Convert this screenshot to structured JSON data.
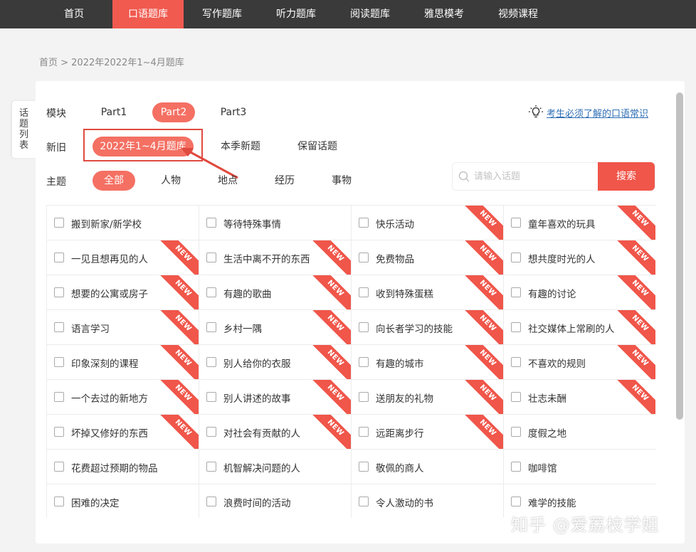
{
  "nav": {
    "items": [
      {
        "label": "首页",
        "active": false
      },
      {
        "label": "口语题库",
        "active": true
      },
      {
        "label": "写作题库",
        "active": false
      },
      {
        "label": "听力题库",
        "active": false
      },
      {
        "label": "阅读题库",
        "active": false
      },
      {
        "label": "雅思模考",
        "active": false
      },
      {
        "label": "视频课程",
        "active": false
      }
    ]
  },
  "breadcrumb": "首页 > 2022年2022年1~4月题库",
  "side_tab": [
    "话",
    "题",
    "列",
    "表"
  ],
  "filters": {
    "module": {
      "label": "模块",
      "options": [
        "Part1",
        "Part2",
        "Part3"
      ],
      "selected": "Part2"
    },
    "age": {
      "label": "新旧",
      "options": [
        "2022年1~4月题库",
        "本季新题",
        "保留话题"
      ],
      "selected": "2022年1~4月题库"
    },
    "theme": {
      "label": "主题",
      "options": [
        "全部",
        "人物",
        "地点",
        "经历",
        "事物"
      ],
      "selected": "全部"
    }
  },
  "tip_link": "考生必须了解的口语常识",
  "search": {
    "placeholder": "请输入话题",
    "button": "搜索"
  },
  "topics": [
    [
      {
        "t": "搬到新家/新学校",
        "new": false
      },
      {
        "t": "等待特殊事情",
        "new": false
      },
      {
        "t": "快乐活动",
        "new": true
      },
      {
        "t": "童年喜欢的玩具",
        "new": true
      }
    ],
    [
      {
        "t": "一见且想再见的人",
        "new": true
      },
      {
        "t": "生活中离不开的东西",
        "new": true
      },
      {
        "t": "免费物品",
        "new": true
      },
      {
        "t": "想共度时光的人",
        "new": true
      }
    ],
    [
      {
        "t": "想要的公寓或房子",
        "new": true
      },
      {
        "t": "有趣的歌曲",
        "new": true
      },
      {
        "t": "收到特殊蛋糕",
        "new": true
      },
      {
        "t": "有趣的讨论",
        "new": true
      }
    ],
    [
      {
        "t": "语言学习",
        "new": true
      },
      {
        "t": "乡村一隅",
        "new": true
      },
      {
        "t": "向长者学习的技能",
        "new": true
      },
      {
        "t": "社交媒体上常刷的人",
        "new": true
      }
    ],
    [
      {
        "t": "印象深刻的课程",
        "new": true
      },
      {
        "t": "别人给你的衣服",
        "new": true
      },
      {
        "t": "有趣的城市",
        "new": true
      },
      {
        "t": "不喜欢的规则",
        "new": true
      }
    ],
    [
      {
        "t": "一个去过的新地方",
        "new": true
      },
      {
        "t": "别人讲述的故事",
        "new": true
      },
      {
        "t": "送朋友的礼物",
        "new": true
      },
      {
        "t": "壮志未酬",
        "new": true
      }
    ],
    [
      {
        "t": "坏掉又修好的东西",
        "new": true
      },
      {
        "t": "对社会有贡献的人",
        "new": true
      },
      {
        "t": "远距离步行",
        "new": true
      },
      {
        "t": "度假之地",
        "new": false
      }
    ],
    [
      {
        "t": "花费超过预期的物品",
        "new": false
      },
      {
        "t": "机智解决问题的人",
        "new": false
      },
      {
        "t": "敬佩的商人",
        "new": false
      },
      {
        "t": "咖啡馆",
        "new": false
      }
    ],
    [
      {
        "t": "困难的决定",
        "new": false
      },
      {
        "t": "浪费时间的活动",
        "new": false
      },
      {
        "t": "令人激动的书",
        "new": false
      },
      {
        "t": "难学的技能",
        "new": false
      }
    ]
  ],
  "ribbon_label": "NEW",
  "watermark": "知乎 @爱荔枝学姐",
  "colors": {
    "accent": "#f0564a",
    "nav_bg": "#3a3a3a",
    "link": "#2f6fb5"
  }
}
